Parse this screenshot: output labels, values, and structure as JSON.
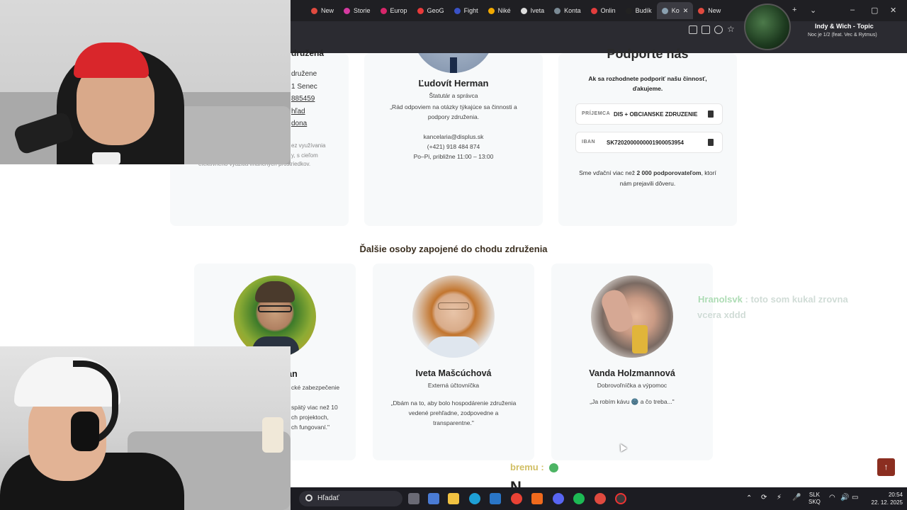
{
  "browser": {
    "tabs": [
      {
        "label": "New",
        "color": "#e04a3f"
      },
      {
        "label": "Storie",
        "color": "#d63aa1"
      },
      {
        "label": "Europ",
        "color": "#d7266a"
      },
      {
        "label": "GeoG",
        "color": "#e83a3a"
      },
      {
        "label": "Fight",
        "color": "#3a52c7"
      },
      {
        "label": "Niké",
        "color": "#f2a900"
      },
      {
        "label": "Iveta",
        "color": "#dddddd"
      },
      {
        "label": "Konta",
        "color": "#7a8a95"
      },
      {
        "label": "Onlin",
        "color": "#e23d3d"
      },
      {
        "label": "Budík",
        "color": "#222222"
      },
      {
        "label": "Ko",
        "color": "#8aa0b0"
      },
      {
        "label": "New",
        "color": "#e04a3f"
      }
    ],
    "window_controls": [
      "+",
      "⌄",
      "–",
      "▢",
      "✕"
    ]
  },
  "now_playing": {
    "title": "Indy & Wich - Topic",
    "subtitle": "Noc je 1/2 (feat. Vec & Rytmus)"
  },
  "left_card": {
    "heading": "družená",
    "lines": [
      "družene",
      "1 Senec",
      "885459",
      "hľad",
      "dona"
    ],
    "note_lines": [
      "ez využívania",
      "y, s cieľom",
      "efektívneho využitia finančných prostriedkov."
    ]
  },
  "person_main": {
    "name": "Ľudovít Herman",
    "role": "Štatutár a správca",
    "quote_lines": [
      "„Rád odpoviem na otázky týkajúce sa činnosti a",
      "podpory združenia."
    ],
    "email": "kancelaria@displus.sk",
    "phone": "(+421) 918 484 874",
    "hours": "Po–Pi, približne 11:00 – 13:00"
  },
  "support": {
    "heading": "Podporte nás",
    "intro_lines": [
      "Ak sa rozhodnete podporiť našu činnosť,",
      "ďakujeme."
    ],
    "recipient_label": "PRÍJEMCA",
    "recipient_value": "DIS + OBCIANSKE ZDRUZENIE",
    "iban_label": "IBAN",
    "iban_value": "SK7202000000001900053954",
    "thanks_prefix": "Sme vďační viac než ",
    "thanks_bold": "2 000 podporovateľom",
    "thanks_suffix": ", ktorí",
    "thanks_line2": "nám prejavili dôveru."
  },
  "others_heading": "Ďalšie osoby zapojené do chodu združenia",
  "others": [
    {
      "name": "man",
      "role": "cké zabezpečenie",
      "quote_lines": [
        "spätý viac než 10",
        "ch projektoch,",
        "ch fungovaní.\""
      ]
    },
    {
      "name": "Iveta Mašcúchová",
      "role": "Externá účtovníčka",
      "quote_lines": [
        "„Dbám na to, aby bolo hospodárenie združenia",
        "vedené prehľadne, zodpovedne a",
        "transparentne.\""
      ]
    },
    {
      "name": "Vanda Holzmannová",
      "role": "Dobrovoľníčka a výpomoc",
      "quote_lines": [
        "„Ja robím kávu 🌚 a čo treba...\""
      ]
    }
  ],
  "next_heading_partial": "N      ",
  "chat": {
    "user1": "Hranolsvk",
    "msg1_line1": ": toto som kukal zrovna",
    "msg1_line2": "vcera xddd",
    "user2": "bremu",
    "msg2": ":"
  },
  "taskbar": {
    "search_label": "Hľadať",
    "lang_top": "SLK",
    "lang_bottom": "SKQ",
    "time": "20:54",
    "date": "22. 12. 2025"
  },
  "scroll_top_label": "↑"
}
